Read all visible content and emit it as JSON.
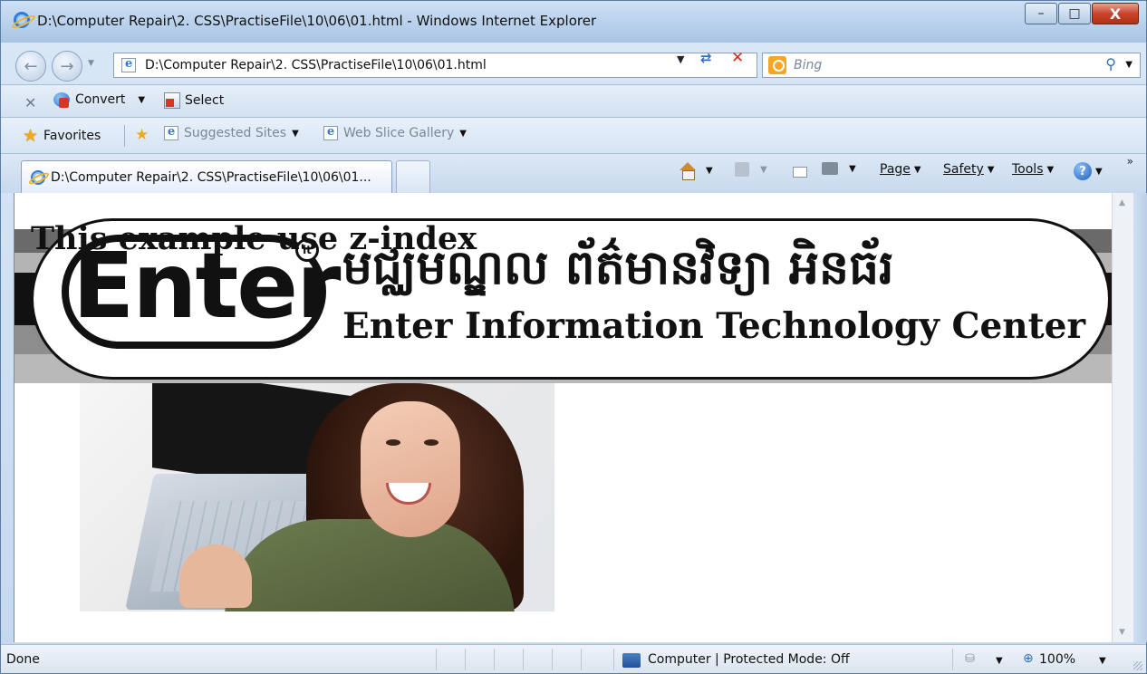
{
  "window": {
    "title": "D:\\Computer Repair\\2. CSS\\PractiseFile\\10\\06\\01.html - Windows Internet Explorer",
    "min_label": "–",
    "max_label": "□",
    "close_label": "X"
  },
  "address_bar": {
    "url": "D:\\Computer Repair\\2. CSS\\PractiseFile\\10\\06\\01.html",
    "search_placeholder": "Bing"
  },
  "convert_bar": {
    "convert_label": "Convert",
    "select_label": "Select"
  },
  "favorites_bar": {
    "favorites_label": "Favorites",
    "suggested_label": "Suggested Sites",
    "webslice_label": "Web Slice Gallery"
  },
  "tabs": [
    {
      "label": "D:\\Computer Repair\\2. CSS\\PractiseFile\\10\\06\\01..."
    }
  ],
  "command_bar": {
    "page": "Page",
    "safety": "Safety",
    "tools": "Tools"
  },
  "content": {
    "heading": "This example use z-index",
    "banner_logo": "Enter",
    "banner_logo_mark": "it",
    "banner_khmer": "មជ្ឈមណ្ឌល ព័ត៌មានវិទ្យា អិនធ័រ",
    "banner_english": "Enter Information Technology Center"
  },
  "status_bar": {
    "status": "Done",
    "zone": "Computer | Protected Mode: Off",
    "zoom": "100%"
  },
  "colors": {
    "banner_stripe_dark": "#111111",
    "banner_stripe_grey": "#7d7d7d",
    "chrome_blue": "#cfe0f1"
  },
  "icons": [
    "ie-logo-icon",
    "back-icon",
    "forward-icon",
    "refresh-icon",
    "stop-icon",
    "bing-icon",
    "search-icon",
    "star-icon",
    "home-icon",
    "feeds-icon",
    "mail-icon",
    "print-icon",
    "help-icon"
  ]
}
